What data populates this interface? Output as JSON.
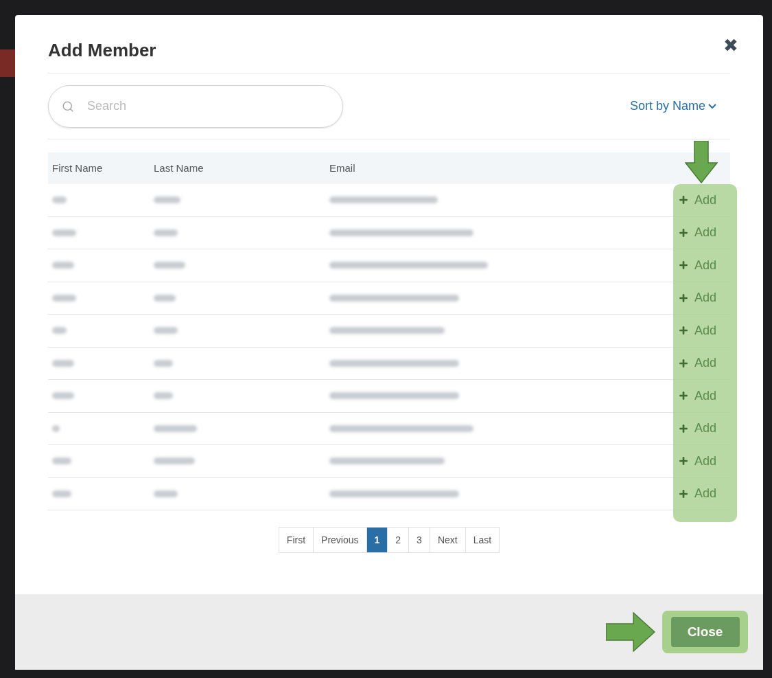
{
  "dialog": {
    "title": "Add Member",
    "close_icon": "✖"
  },
  "search": {
    "placeholder": "Search"
  },
  "sort": {
    "label": "Sort by Name"
  },
  "table": {
    "columns": [
      "First Name",
      "Last Name",
      "Email"
    ],
    "rows": [
      {
        "action": "Add"
      },
      {
        "action": "Add"
      },
      {
        "action": "Add"
      },
      {
        "action": "Add"
      },
      {
        "action": "Add"
      },
      {
        "action": "Add"
      },
      {
        "action": "Add"
      },
      {
        "action": "Add"
      },
      {
        "action": "Add"
      },
      {
        "action": "Add"
      }
    ]
  },
  "pagination": [
    {
      "label": "First",
      "selected": false
    },
    {
      "label": "Previous",
      "selected": false
    },
    {
      "label": "1",
      "selected": true
    },
    {
      "label": "2",
      "selected": false
    },
    {
      "label": "3",
      "selected": false
    },
    {
      "label": "Next",
      "selected": false
    },
    {
      "label": "Last",
      "selected": false
    }
  ],
  "footer": {
    "close_button": "Close"
  }
}
